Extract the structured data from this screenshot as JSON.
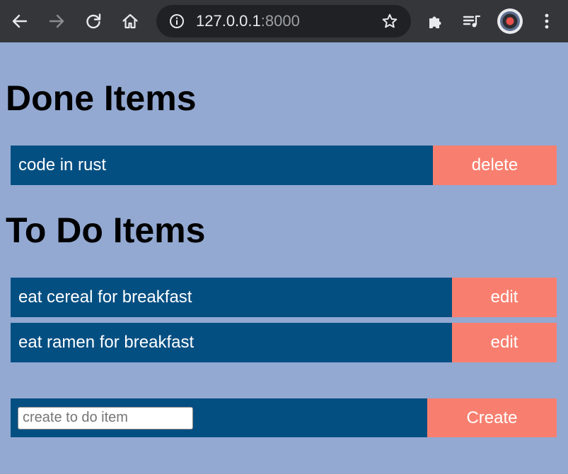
{
  "browser": {
    "url_host": "127.0.0.1",
    "url_port": ":8000",
    "icons": [
      "back-arrow-icon",
      "forward-arrow-icon",
      "reload-icon",
      "home-icon",
      "site-info-icon",
      "bookmark-star-icon",
      "extensions-icon",
      "media-queue-icon",
      "profile-avatar-icon",
      "more-menu-icon"
    ],
    "colors": {
      "toolbar": "#35363a",
      "omnibox": "#202124",
      "page_background": "#93a9d2"
    }
  },
  "done_section": {
    "title": "Done Items",
    "items": [
      {
        "label": "code in rust",
        "action": "delete"
      }
    ]
  },
  "todo_section": {
    "title": "To Do Items",
    "items": [
      {
        "label": "eat cereal for breakfast",
        "action": "edit"
      },
      {
        "label": "eat ramen for breakfast",
        "action": "edit"
      }
    ]
  },
  "create_form": {
    "placeholder": "create to do item",
    "value": "",
    "button_label": "Create"
  },
  "colors": {
    "item_background": "#044f82",
    "button_background": "#f87f6f",
    "text": "#ffffff"
  }
}
